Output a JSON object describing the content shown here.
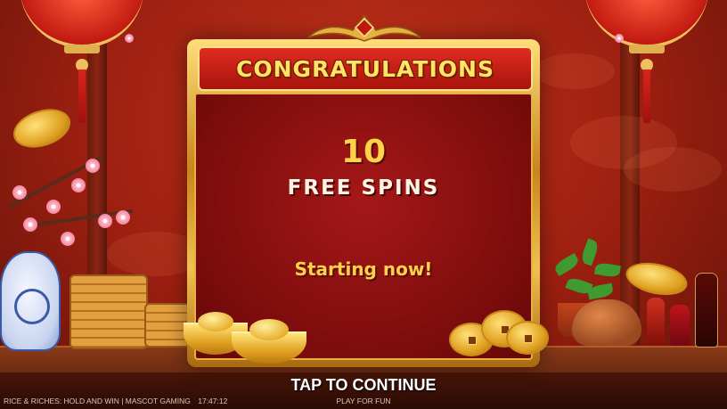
{
  "dialog": {
    "title": "CONGRATULATIONS",
    "spins_count": "10",
    "spins_label": "FREE SPINS",
    "status": "Starting now!"
  },
  "prompt": "TAP TO CONTINUE",
  "footer": {
    "game_info": "RICE & RICHES: HOLD AND WIN | MASCOT GAMING",
    "time": "17:47:12",
    "mode": "PLAY FOR FUN"
  },
  "colors": {
    "background": "#9b1f10",
    "gold": "#ffd24a",
    "banner": "#e02c20",
    "panel": "#7c0c0c"
  },
  "icons": [
    "lantern-icon",
    "gold-coin-icon",
    "gold-ingot-icon",
    "cherry-blossom-icon",
    "vase-icon",
    "teapot-icon"
  ]
}
